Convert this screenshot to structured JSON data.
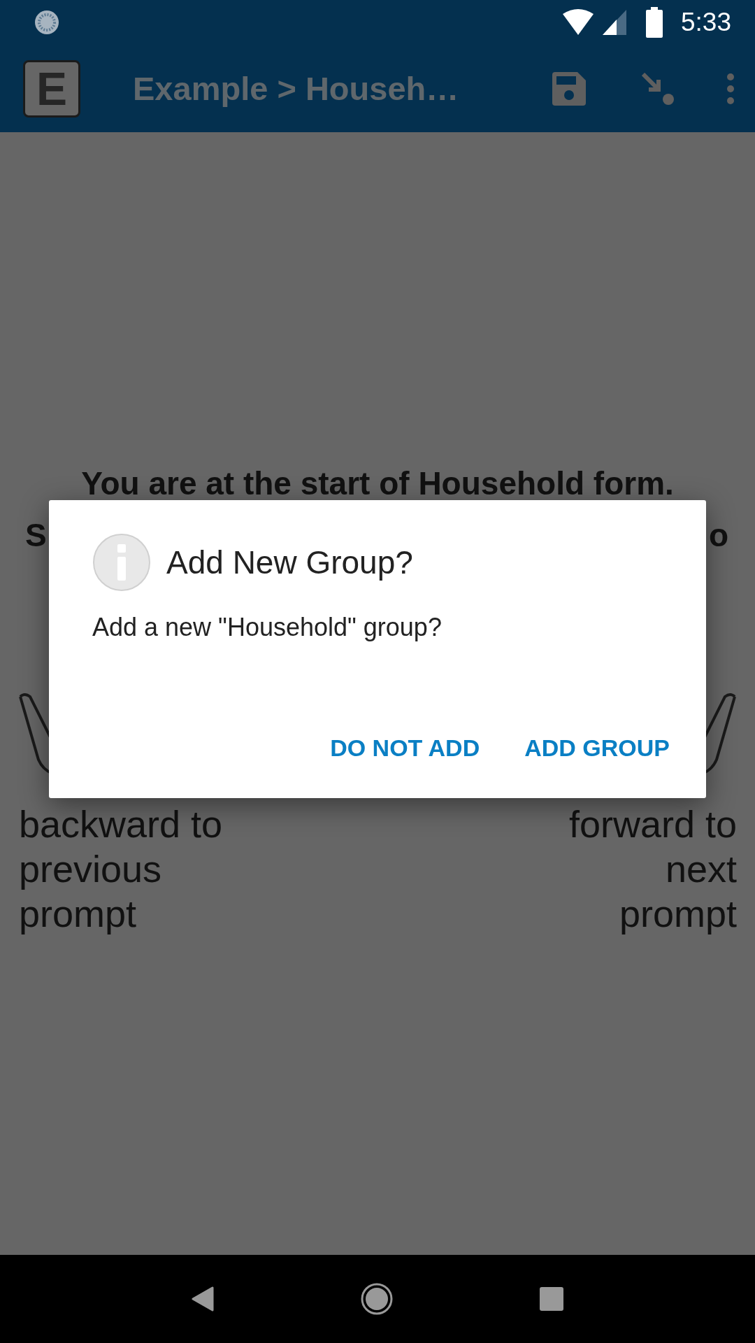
{
  "status_bar": {
    "time": "5:33"
  },
  "app_bar": {
    "logo_letter": "E",
    "title": "Example > Househ…"
  },
  "form": {
    "heading": "You are at the start of Household form.",
    "heading_line_2_start": "S",
    "heading_line_2_end": "o",
    "back_hint": "backward to previous prompt",
    "forward_hint": "forward to next prompt"
  },
  "dialog": {
    "title": "Add New Group?",
    "message": "Add a new \"Household\" group?",
    "buttons": [
      "DO NOT ADD",
      "ADD GROUP"
    ]
  }
}
